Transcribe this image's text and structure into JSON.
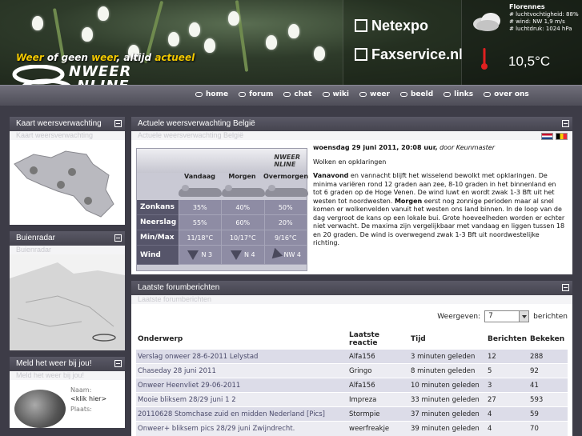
{
  "header": {
    "slogan_part1": "Weer",
    "slogan_part2": " of geen ",
    "slogan_part3": "weer",
    "slogan_part4": ", altijd ",
    "slogan_part5": "actueel",
    "logo_line1": "NWEER",
    "logo_line2": "NLINE",
    "sponsors": [
      "Netexpo",
      "Faxservice.nl"
    ]
  },
  "weather": {
    "city": "Florennes",
    "humidity": "# luchtvochtigheid: 88%",
    "wind": "# wind: NW 1,9 m/s",
    "pressure": "# luchtdruk: 1024 hPa",
    "temperature": "10,5°C"
  },
  "nav": [
    "home",
    "forum",
    "chat",
    "wiki",
    "weer",
    "beeld",
    "links",
    "over ons"
  ],
  "left": {
    "map_title": "Kaart weersverwachting",
    "map_sub": "Kaart weersverwachting",
    "radar_title": "Buienradar",
    "radar_sub": "Buienradar",
    "report_title": "Meld het weer bij jou!",
    "report_sub": "Meld het weer bij jou!",
    "name_label": "Naam:",
    "name_value": "<klik hier>",
    "place_label": "Plaats:"
  },
  "forecast": {
    "title": "Actuele weersverwachting België",
    "sub": "Actuele weersverwachting België",
    "columns": [
      "Vandaag",
      "Morgen",
      "Overmorgen"
    ],
    "rows": [
      {
        "label": "Zonkans",
        "values": [
          "35%",
          "40%",
          "50%"
        ]
      },
      {
        "label": "Neerslag",
        "values": [
          "55%",
          "60%",
          "20%"
        ]
      },
      {
        "label": "Min/Max",
        "values": [
          "11/18°C",
          "10/17°C",
          "9/16°C"
        ]
      },
      {
        "label": "Wind",
        "values": [
          "N 3",
          "N 4",
          "NW 4"
        ]
      }
    ],
    "date": "woensdag 29 juni 2011, 20:08 uur,",
    "author": " door Keunmaster",
    "headline": "Wolken en opklaringen",
    "body_lead1": "Vanavond",
    "body_text1": " en vannacht blijft het wisselend bewolkt met opklaringen. De minima variëren rond 12 graden aan zee, 8-10 graden in het binnenland en tot 6 graden op de Hoge Venen. De wind luwt en wordt zwak 1-3 Bft uit het westen tot noordwesten. ",
    "body_lead2": "Morgen",
    "body_text2": " eerst nog zonnige perioden maar al snel komen er wolkenvelden vanuit het westen ons land binnen. In de loop van de dag vergroot de kans op een lokale bui. Grote hoeveelheden worden er echter niet verwacht. De maxima zijn vergelijkbaar met vandaag en liggen tussen 18 en 20 graden. De wind is overwegend zwak 1-3 Bft uit noordwestelijke richting."
  },
  "forum": {
    "title": "Laatste forumberichten",
    "sub": "Laatste forumberichten",
    "show_label": "Weergeven:",
    "show_value": "7",
    "show_suffix": "berichten",
    "headers": [
      "Onderwerp",
      "Laatste reactie",
      "Tijd",
      "Berichten",
      "Bekeken"
    ],
    "rows": [
      [
        "Verslag onweer 28-6-2011 Lelystad",
        "Alfa156",
        "3 minuten geleden",
        "12",
        "288"
      ],
      [
        "Chaseday 28 juni 2011",
        "Gringo",
        "8 minuten geleden",
        "5",
        "92"
      ],
      [
        "Onweer Heenvliet 29-06-2011",
        "Alfa156",
        "10 minuten geleden",
        "3",
        "41"
      ],
      [
        "Mooie bliksem 28/29 juni 1 2",
        "Impreza",
        "33 minuten geleden",
        "27",
        "593"
      ],
      [
        "20110628 Stomchase zuid en midden Nederland [Pics]",
        "Stormpie",
        "37 minuten geleden",
        "4",
        "59"
      ],
      [
        "Onweer+ bliksem pics 28/29 juni Zwijndrecht.",
        "weerfreakje",
        "39 minuten geleden",
        "4",
        "70"
      ]
    ]
  }
}
